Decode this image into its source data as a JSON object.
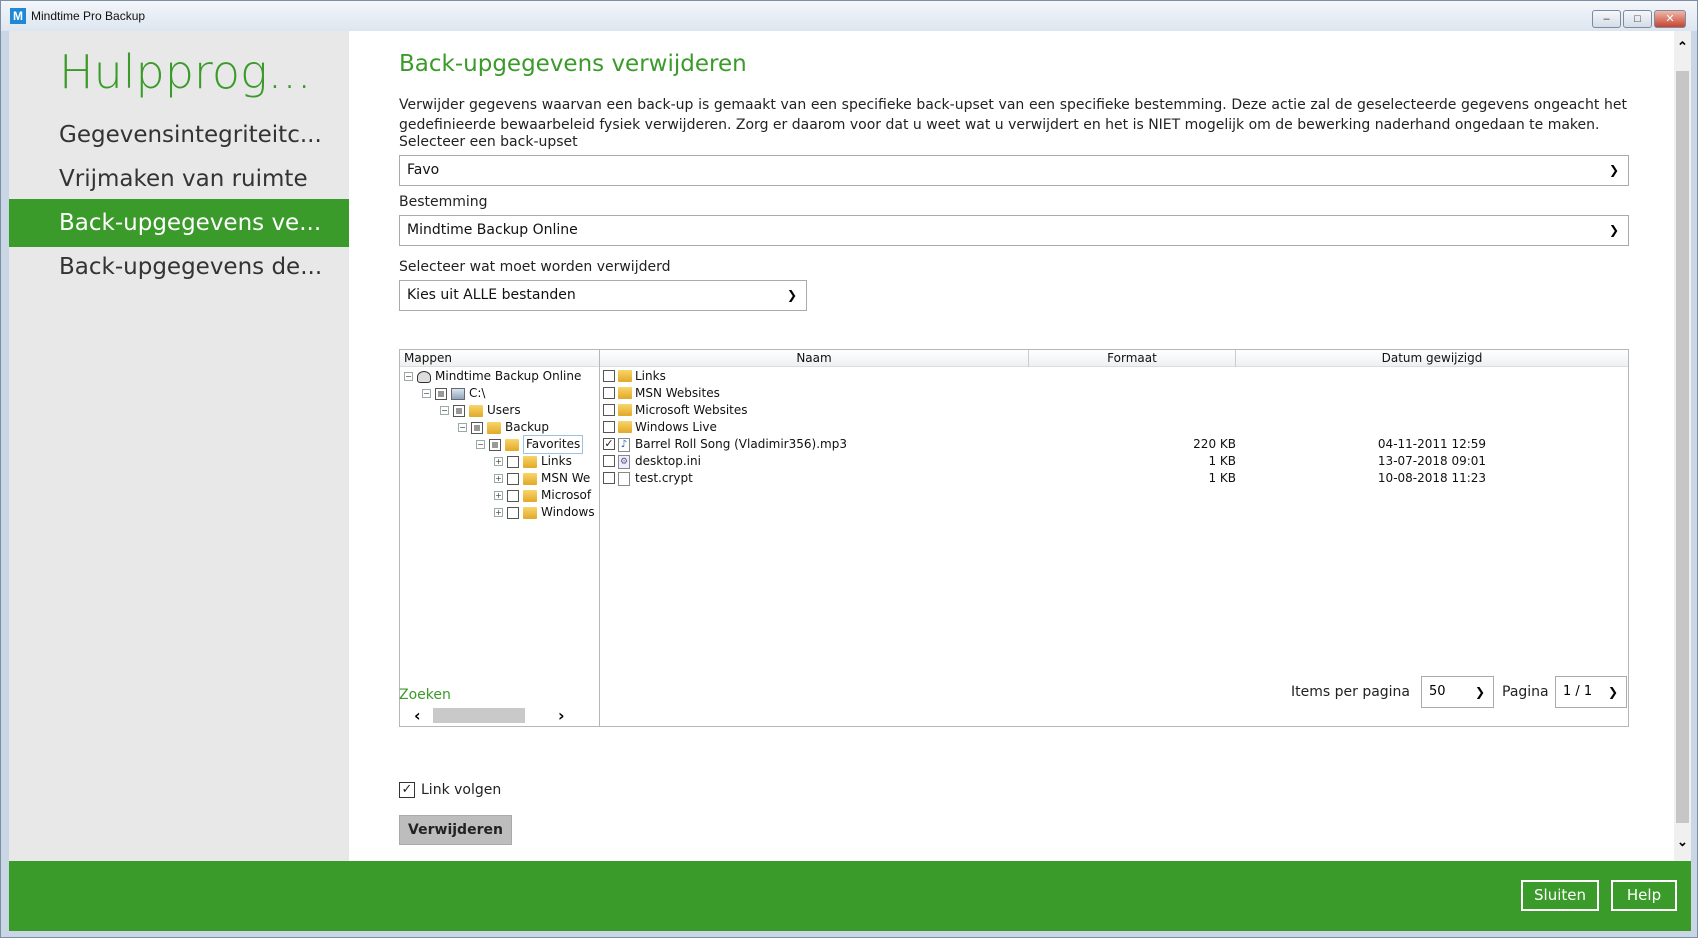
{
  "window": {
    "title": "Mindtime Pro Backup",
    "logo": "M",
    "minimize": "–",
    "maximize": "□",
    "close": "✕"
  },
  "sidebar": {
    "heading": "Hulpprog...",
    "items": [
      {
        "label": "Gegevensintegriteitc..."
      },
      {
        "label": "Vrijmaken van ruimte"
      },
      {
        "label": "Back-upgegevens ve...",
        "active": true
      },
      {
        "label": "Back-upgegevens de..."
      }
    ]
  },
  "main": {
    "title": "Back-upgegevens verwijderen",
    "description": "Verwijder gegevens waarvan een back-up is gemaakt van een specifieke back-upset van een specifieke bestemming. Deze actie zal de geselecteerde gegevens ongeacht het gedefinieerde bewaarbeleid fysiek verwijderen. Zorg er daarom voor dat u weet wat u verwijdert en het is NIET mogelijk om de bewerking naderhand ongedaan te maken.",
    "backupset_label": "Selecteer een back-upset",
    "backupset_value": "Favo",
    "destination_label": "Bestemming",
    "destination_value": "Mindtime Backup Online",
    "select_label": "Selecteer wat moet worden verwijderd",
    "select_value": "Kies uit ALLE bestanden",
    "search_link": "Zoeken",
    "items_per_page_label": "Items per pagina",
    "items_per_page_value": "50",
    "page_label": "Pagina",
    "page_value": "1 / 1",
    "follow_link_label": "Link volgen",
    "follow_link_checked": true,
    "delete_button": "Verwijderen"
  },
  "tree": {
    "header": "Mappen",
    "nodes": [
      {
        "label": "Mindtime Backup Online",
        "level": 0,
        "icon": "cloud-icon"
      },
      {
        "label": "C:\\",
        "level": 1,
        "icon": "drive-icon"
      },
      {
        "label": "Users",
        "level": 2,
        "icon": "folder-icon"
      },
      {
        "label": "Backup",
        "level": 3,
        "icon": "folder-icon"
      },
      {
        "label": "Favorites",
        "level": 4,
        "icon": "favorites-folder-icon",
        "selected": true
      },
      {
        "label": "Links",
        "level": 5,
        "icon": "folder-icon"
      },
      {
        "label": "MSN We",
        "level": 5,
        "icon": "folder-icon"
      },
      {
        "label": "Microsof",
        "level": 5,
        "icon": "folder-icon"
      },
      {
        "label": "Windows",
        "level": 5,
        "icon": "folder-icon"
      }
    ],
    "scroll_left": "‹",
    "scroll_right": "›"
  },
  "files": {
    "columns": [
      "Naam",
      "Formaat",
      "Datum gewijzigd"
    ],
    "rows": [
      {
        "name": "Links",
        "size": "",
        "date": "",
        "icon": "folder-icon",
        "checked": false
      },
      {
        "name": "MSN Websites",
        "size": "",
        "date": "",
        "icon": "folder-icon",
        "checked": false
      },
      {
        "name": "Microsoft Websites",
        "size": "",
        "date": "",
        "icon": "folder-icon",
        "checked": false
      },
      {
        "name": "Windows Live",
        "size": "",
        "date": "",
        "icon": "folder-icon",
        "checked": false
      },
      {
        "name": "Barrel Roll Song (Vladimir356).mp3",
        "size": "220 KB",
        "date": "04-11-2011 12:59",
        "icon": "audio-file-icon",
        "checked": true
      },
      {
        "name": "desktop.ini",
        "size": "1 KB",
        "date": "13-07-2018 09:01",
        "icon": "settings-file-icon",
        "checked": false
      },
      {
        "name": "test.crypt",
        "size": "1 KB",
        "date": "10-08-2018 11:23",
        "icon": "file-icon",
        "checked": false
      }
    ]
  },
  "footer": {
    "close_button": "Sluiten",
    "help_button": "Help"
  },
  "colors": {
    "accent": "#3a9a2a",
    "sidebar_bg": "#e8e8e8"
  }
}
